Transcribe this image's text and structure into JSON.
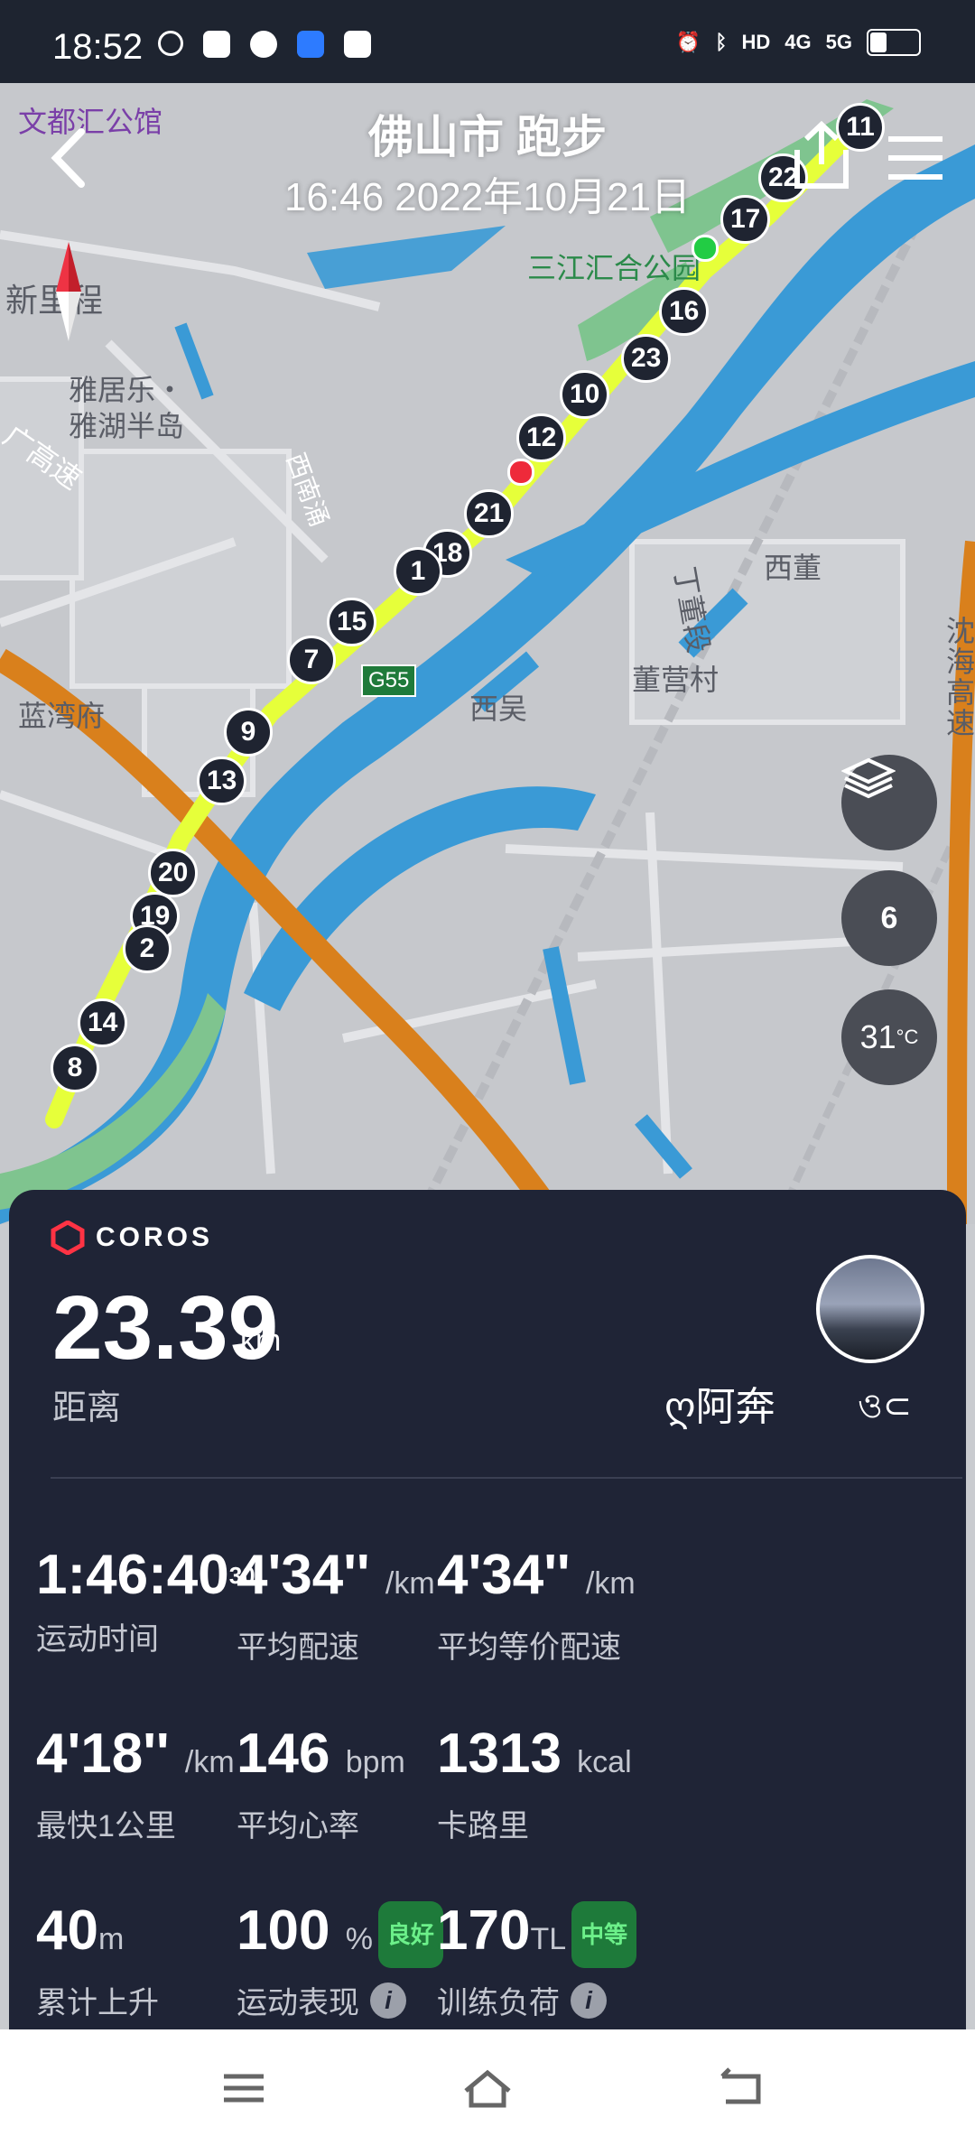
{
  "status": {
    "time": "18:52",
    "network": [
      "4G",
      "5G"
    ]
  },
  "header": {
    "title": "佛山市 跑步",
    "subtitle": "16:46 2022年10月21日"
  },
  "map_labels": {
    "poi_top": "文都汇公馆",
    "area_left": "新里程",
    "poi_mid": "雅居乐・\n雅湖半岛",
    "park": "三江汇合公园",
    "road_left": "广高速",
    "river_road": "西南涌",
    "village1": "西董",
    "road2": "丁董段",
    "village2": "董营村",
    "village3": "西吴",
    "highway": "G55",
    "bottom_left": "蓝湾府",
    "right_highway": "沈海高速"
  },
  "markers": [
    "11",
    "22",
    "17",
    "16",
    "23",
    "10",
    "12",
    "21",
    "18",
    "1",
    "15",
    "7",
    "9",
    "13",
    "20",
    "19",
    "2",
    "14",
    "8"
  ],
  "map_controls": {
    "compass_value": "6",
    "temperature": "31",
    "temp_unit": "°C"
  },
  "panel": {
    "brand": "COROS",
    "distance_value": "23.39",
    "distance_unit": "km",
    "distance_label": "距离",
    "username": "ღ阿奔",
    "username_suffix": "ও⊂",
    "stats": [
      {
        "value": "1:46:40",
        "sup": "30",
        "unit": "",
        "label": "运动时间"
      },
      {
        "value": "4'34''",
        "unit": "/km",
        "label": "平均配速"
      },
      {
        "value": "4'34''",
        "unit": "/km",
        "label": "平均等价配速"
      },
      {
        "value": "4'18''",
        "unit": "/km",
        "label": "最快1公里"
      },
      {
        "value": "146",
        "unit": "bpm",
        "label": "平均心率"
      },
      {
        "value": "1313",
        "unit": "kcal",
        "label": "卡路里"
      },
      {
        "value": "40",
        "unit": "m",
        "label": "累计上升"
      },
      {
        "value": "100",
        "unit": "%",
        "label": "运动表现",
        "badge": "良好",
        "badge_color": "#1e7a3a"
      },
      {
        "value": "170",
        "unit": "TL",
        "label": "训练负荷",
        "badge": "中等",
        "badge_color": "#1e7a3a"
      }
    ]
  },
  "colors": {
    "panel_bg": "#1f2436",
    "route": "#e6ff3a",
    "river": "#3a9ad6",
    "highway": "#d9801c",
    "park": "#7fc48f"
  }
}
